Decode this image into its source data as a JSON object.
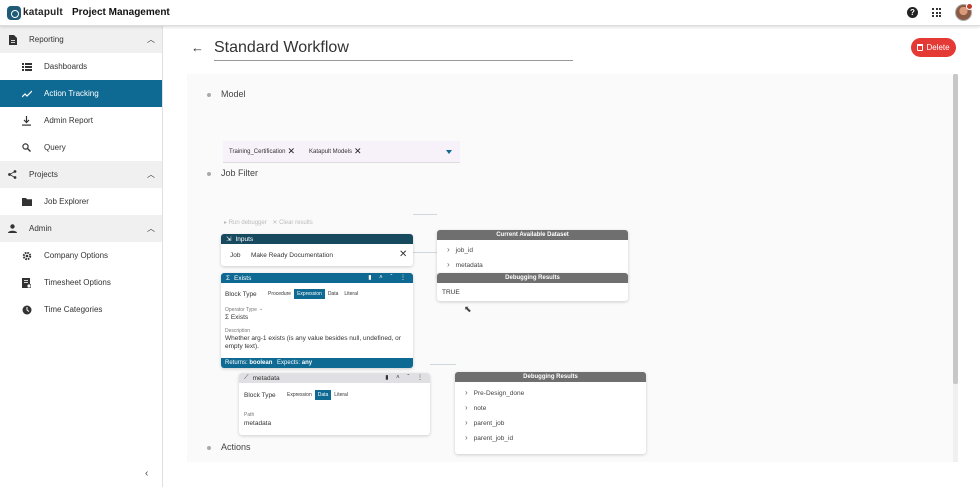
{
  "app": {
    "logo_text": "katapult",
    "title": "Project Management"
  },
  "header": {
    "help_icon": "help-circle-icon",
    "apps_icon": "apps-grid-icon",
    "avatar": "user-avatar"
  },
  "sidebar": {
    "sections": [
      {
        "label": "Reporting",
        "items": [
          "Dashboards",
          "Action Tracking",
          "Admin Report",
          "Query"
        ]
      },
      {
        "label": "Projects",
        "items": [
          "Job Explorer"
        ]
      },
      {
        "label": "Admin",
        "items": [
          "Company Options",
          "Timesheet Options",
          "Time Categories"
        ]
      }
    ],
    "active_item": "Action Tracking",
    "collapse_label": "‹"
  },
  "page": {
    "title": "Standard Workflow",
    "delete_label": "Delete"
  },
  "model": {
    "section_label": "Model",
    "chips": [
      "Training_Certification",
      "Katapult Models"
    ]
  },
  "job_filter": {
    "section_label": "Job Filter",
    "run_debugger": "Run debugger",
    "clear_results": "Clear results",
    "inputs": {
      "title": "Inputs",
      "field_label": "Job",
      "field_value": "Make Ready Documentation"
    },
    "exists": {
      "title": "Exists",
      "block_type_label": "Block Type",
      "block_types": [
        "Procedure",
        "Expression",
        "Data",
        "Literal"
      ],
      "selected_block_type": "Expression",
      "operator_type_label": "Operator Type",
      "operator_type_value": "Σ Exists",
      "description_label": "Description",
      "description_text": "Whether arg-1 exists (is any value besides null, undefined, or empty text).",
      "returns_label": "Returns:",
      "returns_value": "boolean",
      "expects_label": "Expects:",
      "expects_value": "any"
    },
    "metadata": {
      "title": "metadata",
      "block_type_label": "Block Type",
      "block_types": [
        "Expression",
        "Data",
        "Literal"
      ],
      "selected_block_type": "Data",
      "path_label": "Path",
      "path_value": "metadata"
    },
    "available_dataset": {
      "title": "Current Available Dataset",
      "items": [
        "job_id",
        "metadata"
      ]
    },
    "debug_results_1": {
      "title": "Debugging Results",
      "value": "TRUE"
    },
    "debug_results_2": {
      "title": "Debugging Results",
      "items": [
        "Pre-Design_done",
        "note",
        "parent_job",
        "parent_job_id"
      ]
    }
  },
  "actions": {
    "section_label": "Actions"
  },
  "colors": {
    "primary": "#0e6a93",
    "dark_header": "#174a5f",
    "danger": "#e53935",
    "grey_header": "#6f6f6f"
  }
}
